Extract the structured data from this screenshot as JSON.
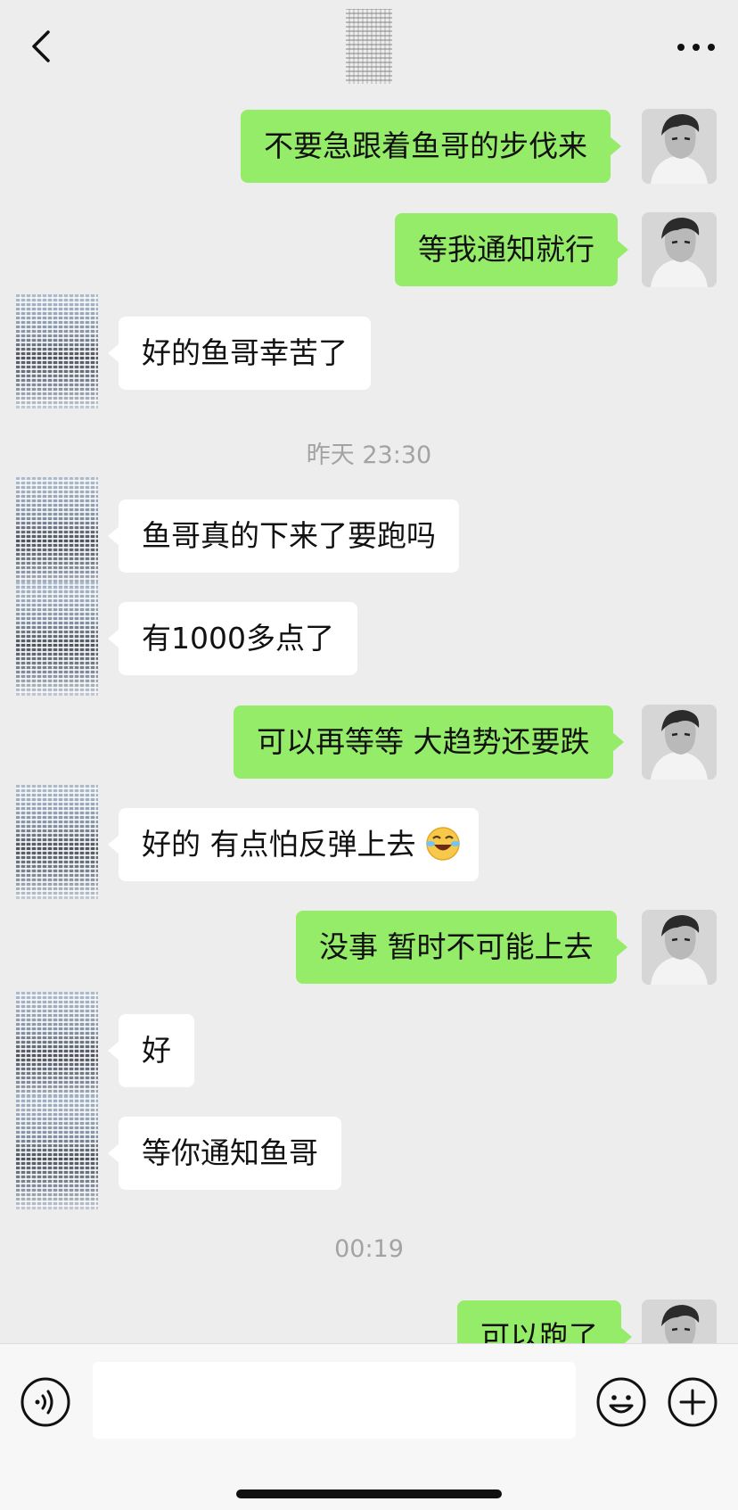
{
  "header": {
    "back_icon": "chevron-left-icon",
    "more_icon": "ellipsis-icon"
  },
  "messages": [
    {
      "side": "out",
      "text": "不要急跟着鱼哥的步伐来"
    },
    {
      "side": "out",
      "text": "等我通知就行"
    },
    {
      "side": "in",
      "text": "好的鱼哥幸苦了"
    },
    {
      "type": "time",
      "text": "昨天 23:30"
    },
    {
      "side": "in",
      "text": "鱼哥真的下来了要跑吗"
    },
    {
      "side": "in",
      "text": "有1000多点了"
    },
    {
      "side": "out",
      "text": "可以再等等 大趋势还要跌"
    },
    {
      "side": "in",
      "text": "好的 有点怕反弹上去",
      "emoji": "laughing-crying-emoji"
    },
    {
      "side": "out",
      "text": "没事 暂时不可能上去"
    },
    {
      "side": "in",
      "text": "好"
    },
    {
      "side": "in",
      "text": "等你通知鱼哥"
    },
    {
      "type": "time",
      "text": "00:19"
    },
    {
      "side": "out",
      "text": "可以跑了"
    }
  ],
  "input_bar": {
    "voice_icon": "voice-icon",
    "input_value": "",
    "emoji_icon": "emoji-icon",
    "plus_icon": "plus-icon"
  },
  "colors": {
    "background": "#ededed",
    "outgoing_bubble": "#95ec69",
    "incoming_bubble": "#ffffff"
  }
}
